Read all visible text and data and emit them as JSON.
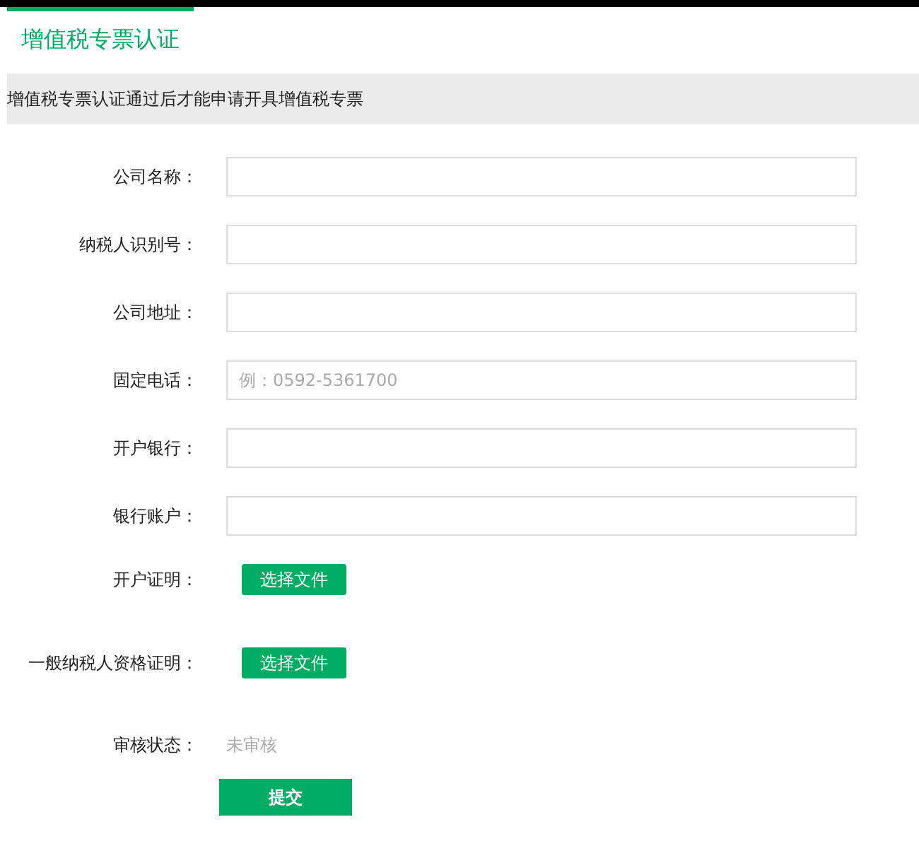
{
  "title": "增值税专票认证",
  "notice": "增值税专票认证通过后才能申请开具增值税专票",
  "fields": [
    {
      "kind": "text",
      "label": "公司名称："
    },
    {
      "kind": "text",
      "label": "纳税人识别号："
    },
    {
      "kind": "text",
      "label": "公司地址："
    },
    {
      "kind": "text",
      "label": "固定电话：",
      "placeholder": "例：0592-5361700"
    },
    {
      "kind": "text",
      "label": "开户银行："
    },
    {
      "kind": "text",
      "label": "银行账户："
    },
    {
      "kind": "file",
      "label": "开户证明：",
      "button": "选择文件"
    },
    {
      "kind": "file",
      "label": "一般纳税人资格证明：",
      "button": "选择文件"
    },
    {
      "kind": "status",
      "label": "审核状态：",
      "value": "未审核"
    }
  ],
  "submit": "提交"
}
